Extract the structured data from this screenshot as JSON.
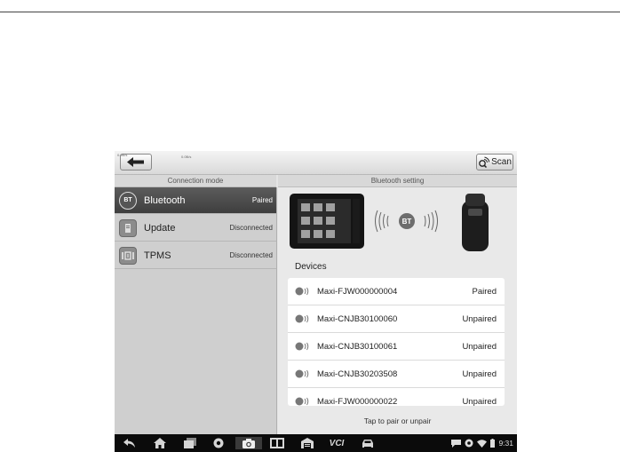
{
  "toolbar": {
    "small_text_1": "0.9B/s",
    "small_text_2": "0.0B/s",
    "scan_label": "Scan"
  },
  "headers": {
    "left": "Connection mode",
    "right": "Bluetooth setting"
  },
  "modes": [
    {
      "label": "Bluetooth",
      "status": "Paired",
      "icon": "bluetooth-icon",
      "icon_text": "BT"
    },
    {
      "label": "Update",
      "status": "Disconnected",
      "icon": "update-icon"
    },
    {
      "label": "TPMS",
      "status": "Disconnected",
      "icon": "tpms-icon"
    }
  ],
  "illustration": {
    "badge": "BT"
  },
  "devices_title": "Devices",
  "devices": [
    {
      "name": "Maxi-FJW000000004",
      "status": "Paired"
    },
    {
      "name": "Maxi-CNJB30100060",
      "status": "Unpaired"
    },
    {
      "name": "Maxi-CNJB30100061",
      "status": "Unpaired"
    },
    {
      "name": "Maxi-CNJB30203508",
      "status": "Unpaired"
    },
    {
      "name": "Maxi-FJW000000022",
      "status": "Unpaired"
    }
  ],
  "tap_text": "Tap to pair or unpair",
  "navbar": {
    "vci_label": "VCI",
    "time": "9:31"
  }
}
